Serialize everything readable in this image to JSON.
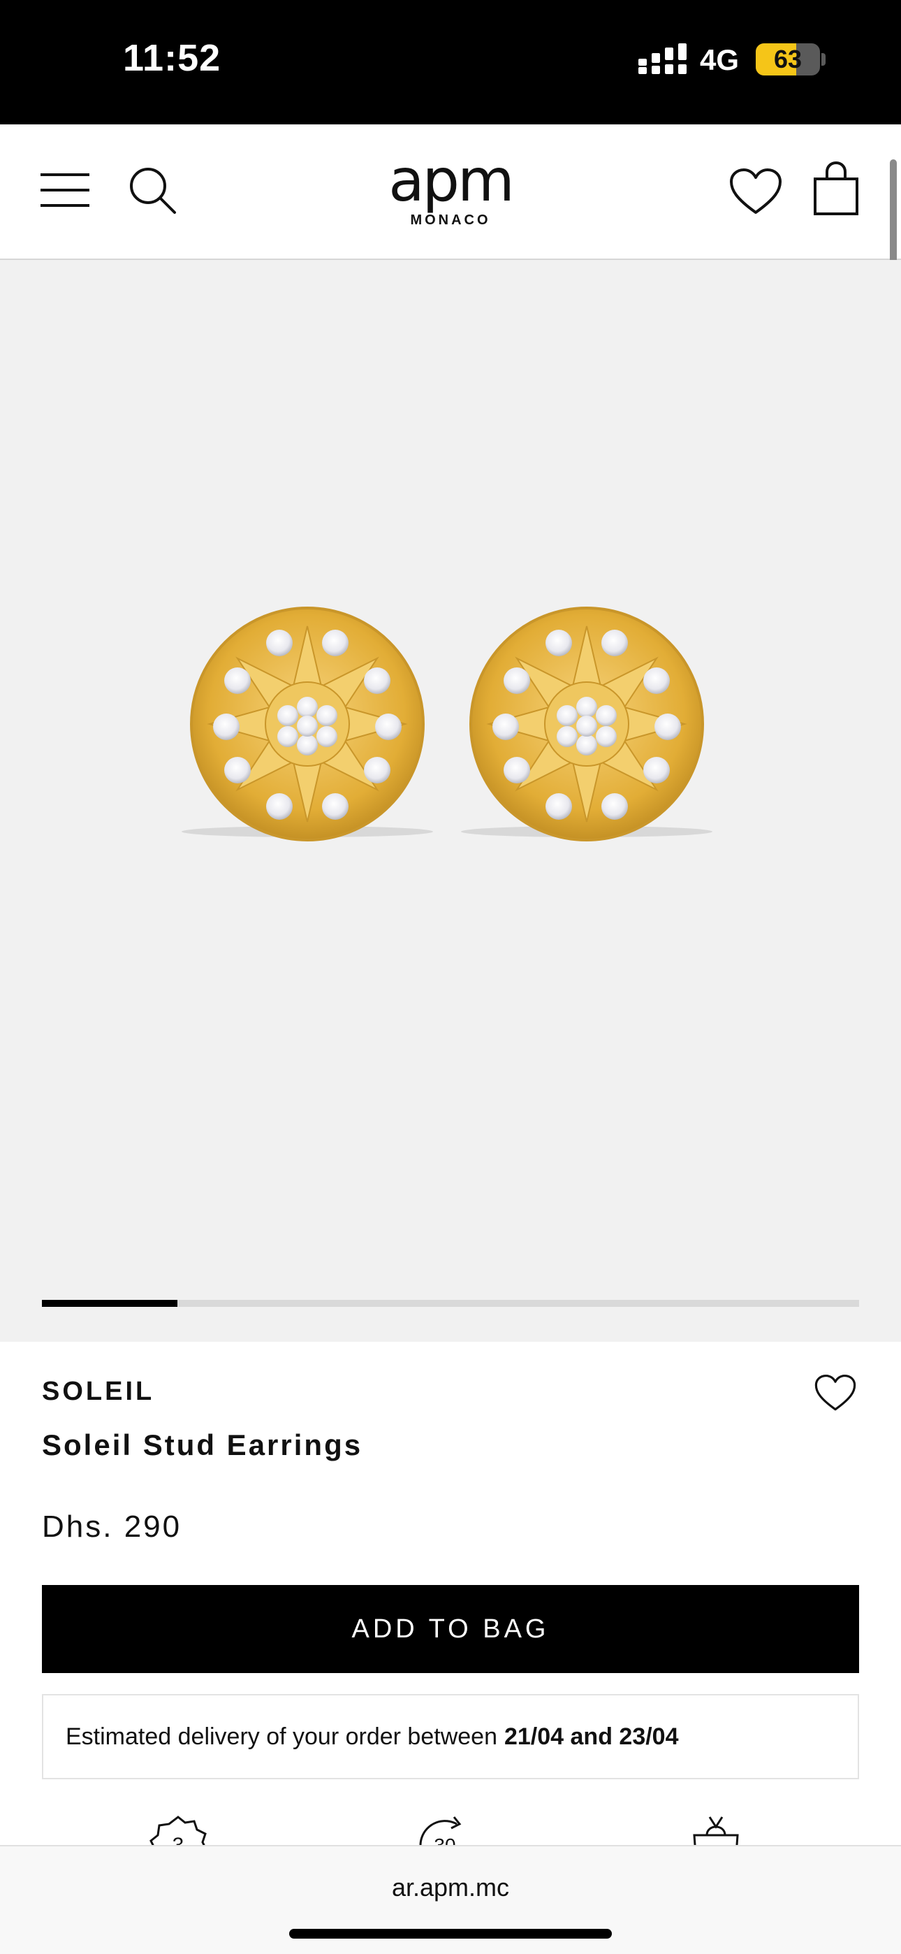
{
  "status_bar": {
    "time": "11:52",
    "network": "4G",
    "battery_level": "63",
    "battery_fraction": 0.63,
    "icons": [
      "signal-bars-icon",
      "battery-icon"
    ]
  },
  "header": {
    "logo_main": "apm",
    "logo_sub": "MONACO",
    "icons": [
      "hamburger-menu-icon",
      "search-icon",
      "heart-icon",
      "shopping-bag-icon"
    ]
  },
  "gallery": {
    "image": "gold-sun-stud-earrings-pair",
    "slide_progress": 0.166
  },
  "product": {
    "collection": "SOLEIL",
    "name": "Soleil Stud Earrings",
    "price": "Dhs. 290",
    "add_to_bag_label": "ADD TO BAG",
    "delivery_text": "Estimated delivery of your order between",
    "delivery_dates": "21/04 and 23/04"
  },
  "features": {
    "icons": [
      "warranty-badge-icon",
      "return-30-days-icon",
      "gift-bag-icon"
    ],
    "warranty_badge_text": "3",
    "return_badge_text": "30"
  },
  "browser": {
    "url": "ar.apm.mc"
  },
  "colors": {
    "accent": "#000000",
    "gold": "#e8b93a",
    "battery_yellow": "#f5c518",
    "gallery_bg": "#f1f1f1"
  }
}
